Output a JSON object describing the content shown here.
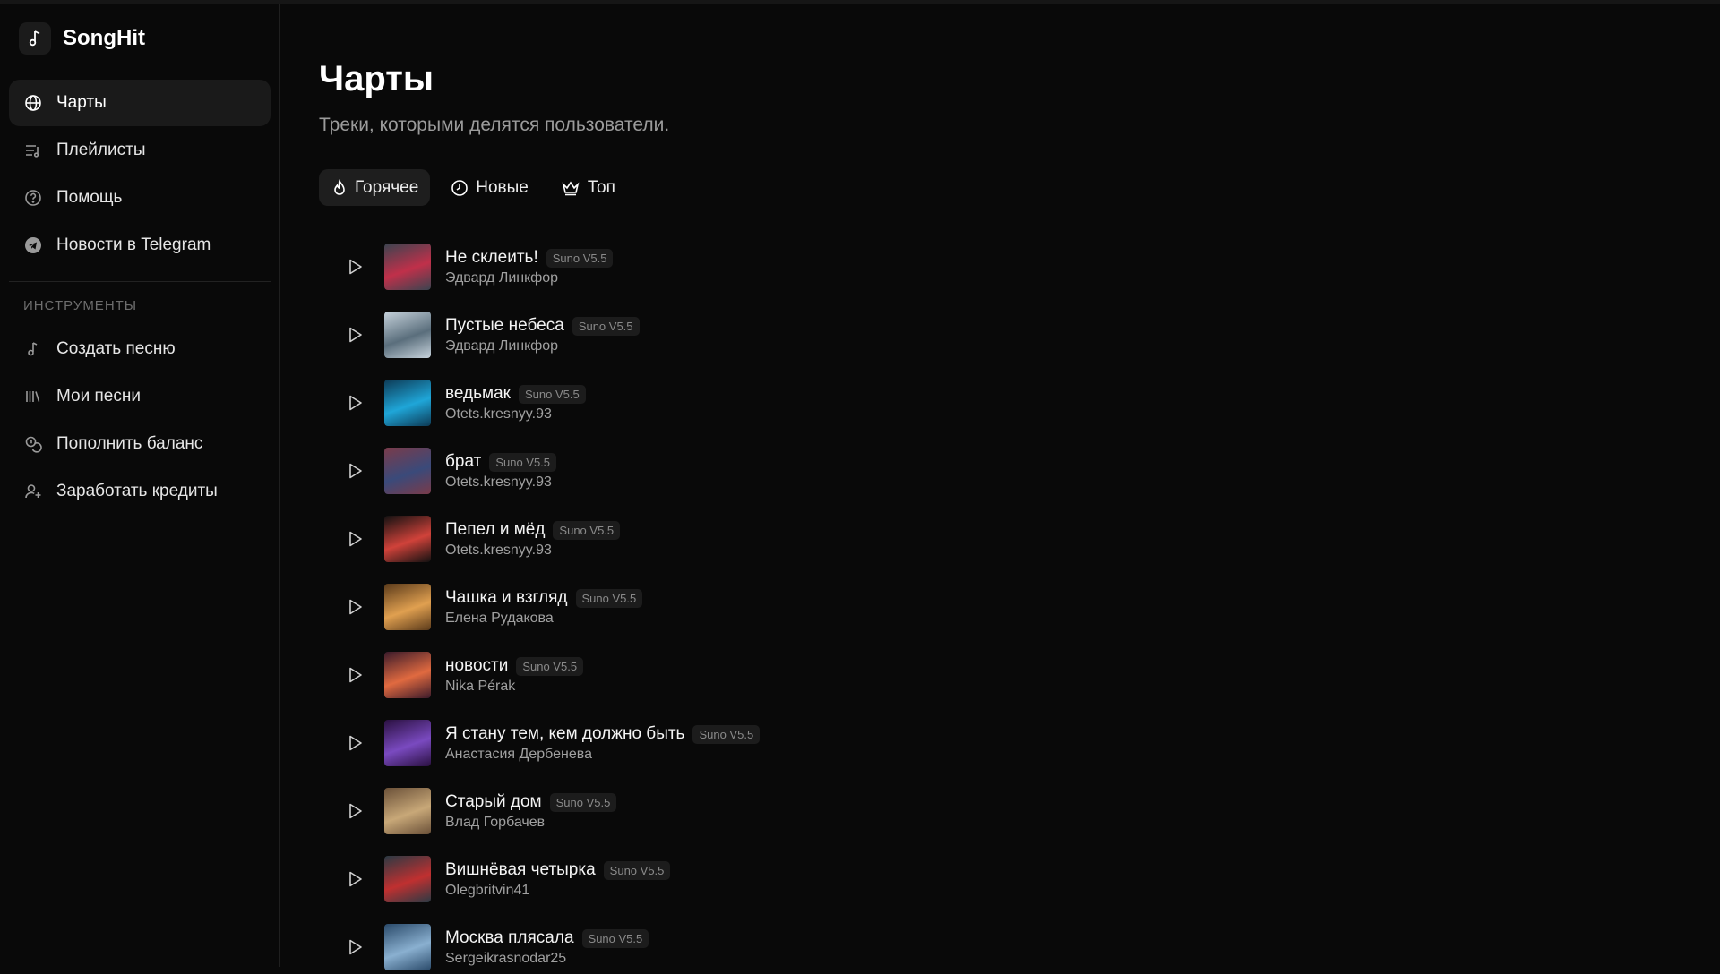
{
  "app": {
    "name": "SongHit",
    "logo_icon": "music-note-icon"
  },
  "sidebar": {
    "items": [
      {
        "label": "Чарты",
        "icon": "globe-icon",
        "active": true
      },
      {
        "label": "Плейлисты",
        "icon": "playlist-icon",
        "active": false
      },
      {
        "label": "Помощь",
        "icon": "help-circle-icon",
        "active": false
      },
      {
        "label": "Новости в Telegram",
        "icon": "telegram-icon",
        "active": false
      }
    ],
    "section_label": "ИНСТРУМЕНТЫ",
    "tools": [
      {
        "label": "Создать песню",
        "icon": "music-note-icon"
      },
      {
        "label": "Мои песни",
        "icon": "library-icon"
      },
      {
        "label": "Пополнить баланс",
        "icon": "coins-icon"
      },
      {
        "label": "Заработать кредиты",
        "icon": "user-plus-icon"
      }
    ]
  },
  "main": {
    "title": "Чарты",
    "subtitle": "Треки, которыми делятся пользователи.",
    "tabs": [
      {
        "label": "Горячее",
        "icon": "flame-icon",
        "active": true
      },
      {
        "label": "Новые",
        "icon": "clock-icon",
        "active": false
      },
      {
        "label": "Топ",
        "icon": "crown-icon",
        "active": false
      }
    ],
    "tracks": [
      {
        "title": "Не склеить!",
        "badge": "Suno V5.5",
        "artist": "Эдвард Линкфор",
        "colors": [
          "#3a4450",
          "#c0304a"
        ]
      },
      {
        "title": "Пустые небеса",
        "badge": "Suno V5.5",
        "artist": "Эдвард Линкфор",
        "colors": [
          "#c7d3dc",
          "#5a6e7c"
        ]
      },
      {
        "title": "ведьмак",
        "badge": "Suno V5.5",
        "artist": "Otets.kresnyy.93",
        "colors": [
          "#0d3a55",
          "#1fa6d8"
        ]
      },
      {
        "title": "брат",
        "badge": "Suno V5.5",
        "artist": "Otets.kresnyy.93",
        "colors": [
          "#7a3b4a",
          "#3a4a7a"
        ]
      },
      {
        "title": "Пепел и мёд",
        "badge": "Suno V5.5",
        "artist": "Otets.kresnyy.93",
        "colors": [
          "#111111",
          "#d0423a"
        ]
      },
      {
        "title": "Чашка и взгляд",
        "badge": "Suno V5.5",
        "artist": "Елена Рудакова",
        "colors": [
          "#5a3a1a",
          "#e0a050"
        ]
      },
      {
        "title": "новости",
        "badge": "Suno V5.5",
        "artist": "Nika Pérak",
        "colors": [
          "#3a1a2a",
          "#e06a40"
        ]
      },
      {
        "title": "Я стану тем, кем должно быть",
        "badge": "Suno V5.5",
        "artist": "Анастасия Дербенева",
        "colors": [
          "#2a1040",
          "#7a4ac0"
        ]
      },
      {
        "title": "Старый дом",
        "badge": "Suno V5.5",
        "artist": "Влад Горбачев",
        "colors": [
          "#6a5038",
          "#c8a878"
        ]
      },
      {
        "title": "Вишнёвая четырка",
        "badge": "Suno V5.5",
        "artist": "Olegbritvin41",
        "colors": [
          "#2a3a44",
          "#c03030"
        ]
      },
      {
        "title": "Москва плясала",
        "badge": "Suno V5.5",
        "artist": "Sergeikrasnodar25",
        "colors": [
          "#2a4a6a",
          "#8ab0d0"
        ]
      }
    ]
  }
}
